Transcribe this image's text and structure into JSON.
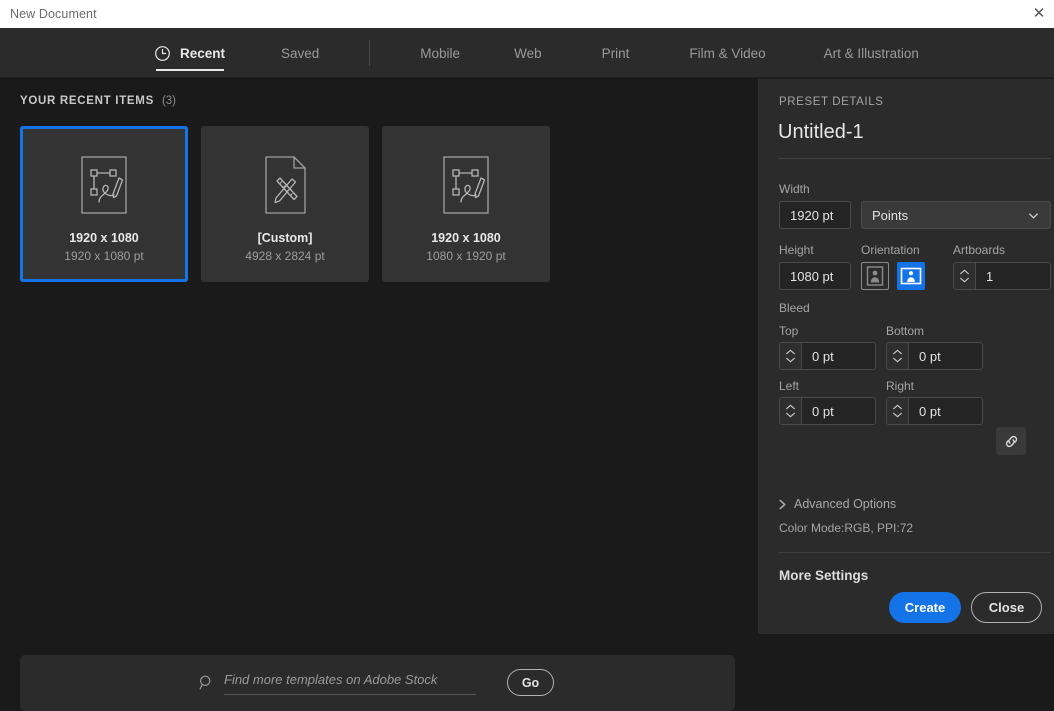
{
  "window": {
    "title": "New Document",
    "close_icon": "close-icon",
    "close_glyph": "✕"
  },
  "tabs": [
    {
      "label": "Recent",
      "icon": "clock-icon",
      "active": true
    },
    {
      "label": "Saved",
      "icon": "",
      "active": false
    },
    {
      "label": "Mobile",
      "icon": "",
      "active": false
    },
    {
      "label": "Web",
      "icon": "",
      "active": false
    },
    {
      "label": "Print",
      "icon": "",
      "active": false
    },
    {
      "label": "Film & Video",
      "icon": "",
      "active": false
    },
    {
      "label": "Art & Illustration",
      "icon": "",
      "active": false
    }
  ],
  "recent": {
    "heading": "YOUR RECENT ITEMS",
    "count": "(3)",
    "items": [
      {
        "label": "1920 x 1080",
        "dimensions": "1920 x 1080 pt",
        "icon": "artboard-vector-icon",
        "selected": true
      },
      {
        "label": "[Custom]",
        "dimensions": "4928 x 2824 pt",
        "icon": "document-tools-icon",
        "selected": false
      },
      {
        "label": "1920 x 1080",
        "dimensions": "1080 x 1920 pt",
        "icon": "artboard-vector-icon",
        "selected": false
      }
    ]
  },
  "search": {
    "icon": "search-icon",
    "placeholder": "Find more templates on Adobe Stock",
    "value": "",
    "go_label": "Go"
  },
  "preset": {
    "section_label": "PRESET DETAILS",
    "name": "Untitled-1",
    "width": {
      "label": "Width",
      "value": "1920 pt"
    },
    "units": {
      "value": "Points",
      "icon": "chevron-down-icon"
    },
    "height": {
      "label": "Height",
      "value": "1080 pt"
    },
    "orientation": {
      "label": "Orientation",
      "portrait_icon": "portrait-orientation-icon",
      "landscape_icon": "landscape-orientation-icon",
      "selected": "landscape"
    },
    "artboards": {
      "label": "Artboards",
      "value": "1"
    },
    "bleed": {
      "label": "Bleed",
      "top": {
        "label": "Top",
        "value": "0 pt"
      },
      "bottom": {
        "label": "Bottom",
        "value": "0 pt"
      },
      "left": {
        "label": "Left",
        "value": "0 pt"
      },
      "right": {
        "label": "Right",
        "value": "0 pt"
      },
      "link_icon": "link-icon"
    },
    "advanced_options": {
      "label": "Advanced Options",
      "icon": "chevron-right-icon"
    },
    "color_mode_line": "Color Mode:RGB, PPI:72",
    "more_settings": "More Settings"
  },
  "actions": {
    "create_label": "Create",
    "close_label": "Close"
  },
  "colors": {
    "accent": "#1473e6",
    "left_panel_bg": "#1a1a1a",
    "right_panel_bg": "#2b2b2b",
    "card_bg": "#333333",
    "titlebar_bg": "#ffffff"
  }
}
